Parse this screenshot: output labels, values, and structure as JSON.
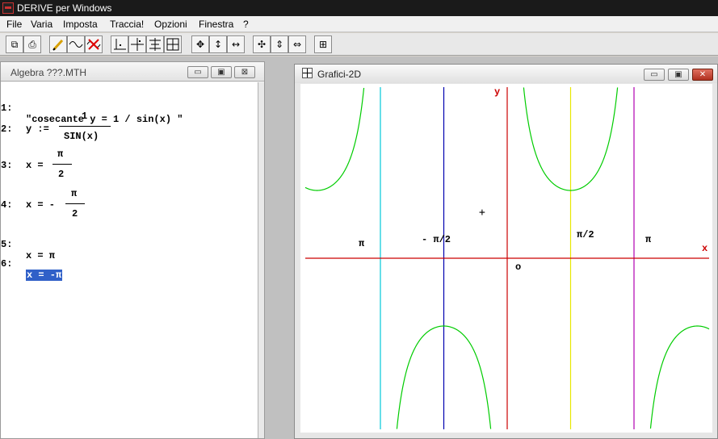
{
  "app": {
    "title": "DERIVE per Windows"
  },
  "menu": [
    "File",
    "Varia",
    "Imposta",
    "Traccia!",
    "Opzioni",
    "Finestra",
    "?"
  ],
  "toolbar": [
    "copy-icon",
    "print-icon",
    "pencil-icon",
    "wave-icon",
    "delete-plot-icon",
    "axes-icon",
    "cross-icon",
    "scale-icon",
    "grid-icon",
    "move-all-icon",
    "move-vertical-icon",
    "move-horizontal-icon",
    "zoom-in-icon",
    "zoom-vertical-icon",
    "zoom-horizontal-icon",
    "window-plot-icon"
  ],
  "algebra": {
    "title": "Algebra  ???.MTH",
    "btn_min": "▭",
    "btn_max": "▣",
    "btn_close": "⊠",
    "lines": {
      "l1": {
        "num": "1:",
        "text": "\"cosecante y = 1 / sin(x) \""
      },
      "l2": {
        "num": "2:",
        "lhs": "y :=",
        "numer": "1",
        "denom": "SIN(x)"
      },
      "l3": {
        "num": "3:",
        "lhs": "x =",
        "numer": "π",
        "denom": "2"
      },
      "l4": {
        "num": "4:",
        "lhs": "x = -",
        "numer": "π",
        "denom": "2"
      },
      "l5": {
        "num": "5:",
        "text": "x = π"
      },
      "l6": {
        "num": "6:",
        "text": "x = -π"
      }
    }
  },
  "graph": {
    "title": "Grafici-2D",
    "btn_min": "▭",
    "btn_max": "▣",
    "btn_close": "✕",
    "labels": {
      "y": "y",
      "x": "x",
      "origin": "o",
      "pi_left": "π",
      "minus_pi_half": "- π/2",
      "pi_half": "π/2",
      "pi_right": "π",
      "cursor": "+"
    },
    "colors": {
      "axes": "#cc0000",
      "curve": "#00cc00",
      "line_minus_pi": "#00c8d8",
      "line_minus_pi_half": "#0000b0",
      "line_pi_half": "#e8e800",
      "line_pi": "#b000b0"
    },
    "chart_data": {
      "type": "line",
      "function": "csc(x) = 1/sin(x)",
      "vertical_lines": [
        {
          "x_label": "-π",
          "color": "#00c8d8"
        },
        {
          "x_label": "-π/2",
          "color": "#0000b0"
        },
        {
          "x_label": "π/2",
          "color": "#e8e800"
        },
        {
          "x_label": "π",
          "color": "#b000b0"
        }
      ]
    }
  }
}
